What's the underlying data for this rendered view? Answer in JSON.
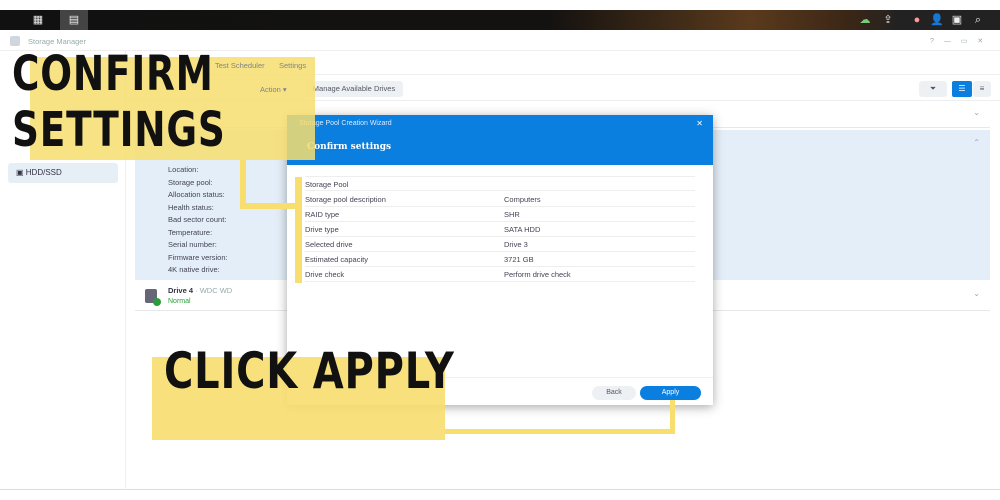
{
  "taskbar": {
    "icons": [
      "apps-grid-icon",
      "storage-manager-icon",
      "cloud-sync-icon",
      "upload-icon",
      "chat-icon",
      "user-icon",
      "widget-icon",
      "search-icon"
    ]
  },
  "window": {
    "title": "Storage Manager",
    "controls": [
      "?",
      "—",
      "▭",
      "✕"
    ]
  },
  "tabs": {
    "test_scheduler": "Test Scheduler",
    "settings": "Settings"
  },
  "toolbar": {
    "action": "Action ▾",
    "manage": "Manage Available Drives"
  },
  "sidebar": {
    "items": [
      {
        "label": "HDD/SSD"
      }
    ]
  },
  "drive_details": {
    "labels": [
      "Location:",
      "Storage pool:",
      "Allocation status:",
      "Health status:",
      "Bad sector count:",
      "Temperature:",
      "Serial number:",
      "Firmware version:",
      "4K native drive:"
    ]
  },
  "drive4": {
    "name": "Drive 4",
    "model": "· WDC WD",
    "status": "Normal"
  },
  "dialog": {
    "title": "Storage Pool Creation Wizard",
    "heading": "Confirm settings",
    "section": "Storage Pool",
    "rows": [
      {
        "label": "Storage pool description",
        "value": "Computers"
      },
      {
        "label": "RAID type",
        "value": "SHR"
      },
      {
        "label": "Drive type",
        "value": "SATA HDD"
      },
      {
        "label": "Selected drive",
        "value": "Drive 3"
      },
      {
        "label": "Estimated capacity",
        "value": "3721 GB"
      },
      {
        "label": "Drive check",
        "value": "Perform drive check"
      }
    ],
    "back": "Back",
    "apply": "Apply",
    "close": "✕"
  },
  "overlay": {
    "top_line1": "CONFIRM",
    "top_line2": "SETTINGS",
    "bottom": "CLICK APPLY",
    "color": "#f7de6e"
  },
  "colors": {
    "accent": "#0b7fe0",
    "normal": "#2a9d3a"
  }
}
